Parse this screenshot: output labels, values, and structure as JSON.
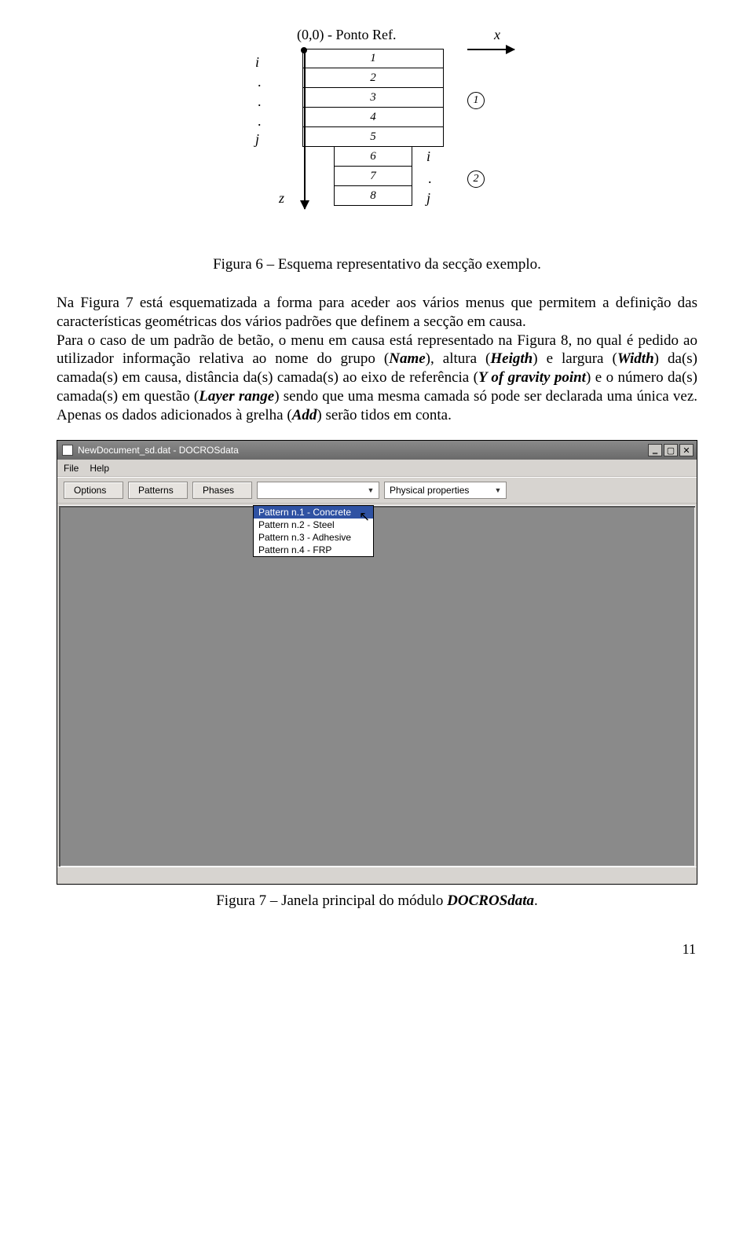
{
  "diagram": {
    "ref_label": "(0,0) - Ponto Ref.",
    "x_label": "x",
    "z_label": "z",
    "left_col": [
      "i",
      ".",
      ".",
      ".",
      "j"
    ],
    "right_col": [
      "i",
      ".",
      "j"
    ],
    "layers": [
      "1",
      "2",
      "3",
      "4",
      "5",
      "6",
      "7",
      "8"
    ],
    "circled": [
      "1",
      "2"
    ]
  },
  "caption1": "Figura 6 – Esquema representativo da secção exemplo.",
  "para1_a": "Na Figura 7 está esquematizada a forma para aceder aos vários menus que permitem a definição das características geométricas dos vários padrões que definem a secção em causa.",
  "para1_b1": "Para o caso de um padrão de betão, o menu em causa está representado na Figura 8, no qual é pedido ao utilizador informação relativa ao nome do grupo (",
  "para1_name": "Name",
  "para1_b2": "), altura (",
  "para1_heigth": "Heigth",
  "para1_b3": ") e largura (",
  "para1_width": "Width",
  "para1_b4": ") da(s) camada(s) em causa, distância da(s) camada(s) ao eixo de referência (",
  "para1_y": "Y of gravity point",
  "para1_b5": ") e o número da(s) camada(s) em questão (",
  "para1_layer": "Layer range",
  "para1_b6": ") sendo que uma mesma camada só pode ser declarada uma única vez. Apenas os dados adicionados à grelha (",
  "para1_add": "Add",
  "para1_b7": ") serão tidos em conta.",
  "window": {
    "title": "NewDocument_sd.dat - DOCROSdata",
    "menus": [
      "File",
      "Help"
    ],
    "buttons": [
      "Options",
      "Patterns",
      "Phases"
    ],
    "sel1": "",
    "sel2": "Physical properties",
    "dropdown": [
      "Pattern n.1 - Concrete",
      "Pattern n.2 - Steel",
      "Pattern n.3 - Adhesive",
      "Pattern n.4 - FRP"
    ]
  },
  "caption2_a": "Figura 7 – Janela principal do módulo ",
  "caption2_b": "DOCROSdata",
  "caption2_c": ".",
  "page_number": "11"
}
